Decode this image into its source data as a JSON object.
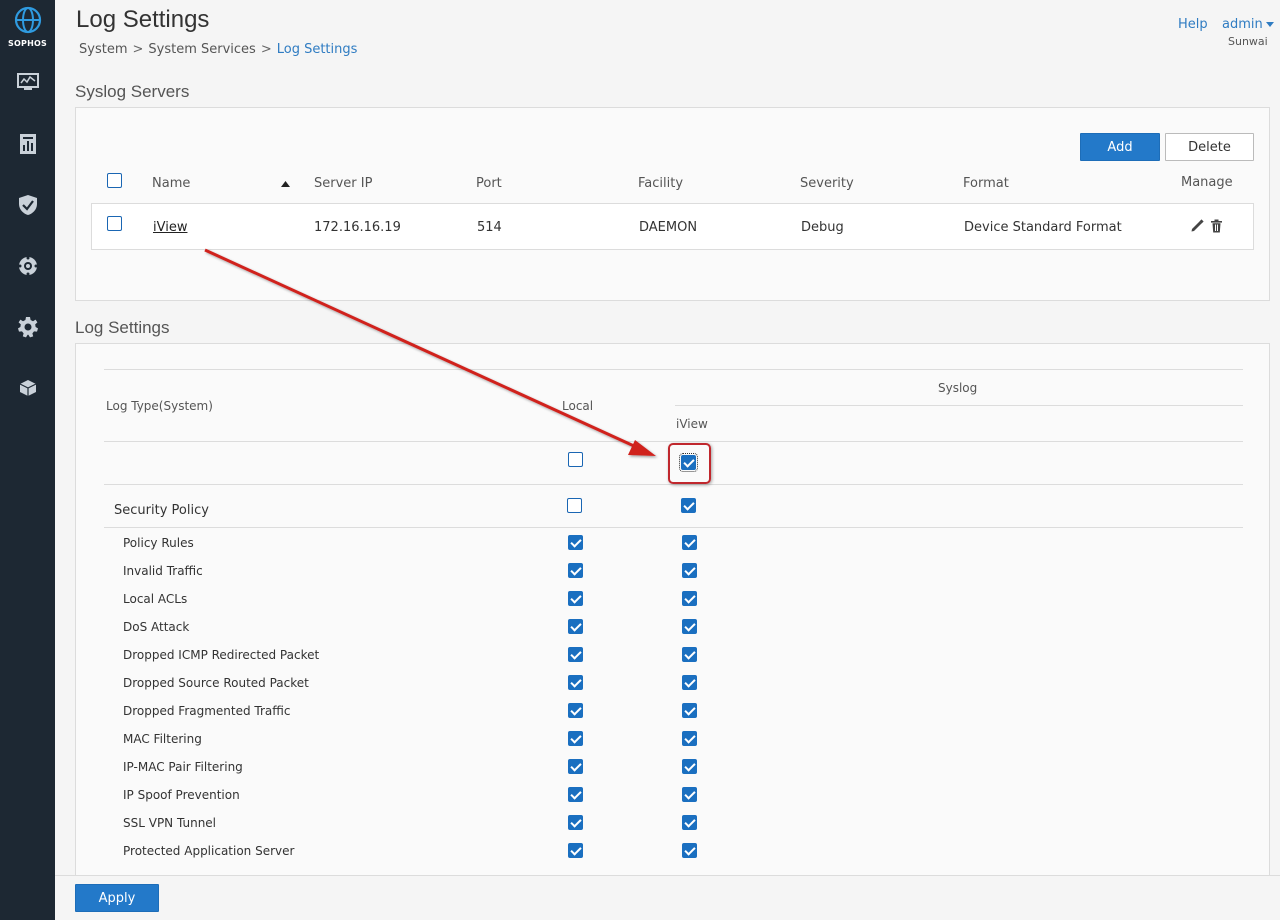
{
  "sidebar": {
    "logo_text": "SOPHOS",
    "items": [
      {
        "name": "monitor-icon"
      },
      {
        "name": "reports-icon"
      },
      {
        "name": "protect-icon"
      },
      {
        "name": "configure-icon"
      },
      {
        "name": "system-settings-icon"
      },
      {
        "name": "package-icon"
      }
    ]
  },
  "header": {
    "title": "Log Settings",
    "breadcrumb": [
      "System",
      "System Services",
      "Log Settings"
    ],
    "help": "Help",
    "user": "admin",
    "org": "Sunwai"
  },
  "syslog": {
    "section_title": "Syslog Servers",
    "add_label": "Add",
    "delete_label": "Delete",
    "columns": {
      "name": "Name",
      "server_ip": "Server IP",
      "port": "Port",
      "facility": "Facility",
      "severity": "Severity",
      "format": "Format",
      "manage": "Manage"
    },
    "rows": [
      {
        "name": "iView",
        "server_ip": "172.16.16.19",
        "port": "514",
        "facility": "DAEMON",
        "severity": "Debug",
        "format": "Device Standard Format"
      }
    ]
  },
  "log_settings": {
    "section_title": "Log Settings",
    "log_type_header": "Log Type(System)",
    "local_header": "Local",
    "syslog_header": "Syslog",
    "server_header": "iView",
    "select_all": {
      "local": false,
      "iview": true
    },
    "group": {
      "label": "Security Policy",
      "local": false,
      "iview": true
    },
    "items": [
      {
        "label": "Policy Rules",
        "local": true,
        "iview": true
      },
      {
        "label": "Invalid Traffic",
        "local": true,
        "iview": true
      },
      {
        "label": "Local ACLs",
        "local": true,
        "iview": true
      },
      {
        "label": "DoS Attack",
        "local": true,
        "iview": true
      },
      {
        "label": "Dropped ICMP Redirected Packet",
        "local": true,
        "iview": true
      },
      {
        "label": "Dropped Source Routed Packet",
        "local": true,
        "iview": true
      },
      {
        "label": "Dropped Fragmented Traffic",
        "local": true,
        "iview": true
      },
      {
        "label": "MAC Filtering",
        "local": true,
        "iview": true
      },
      {
        "label": "IP-MAC Pair Filtering",
        "local": true,
        "iview": true
      },
      {
        "label": "IP Spoof Prevention",
        "local": true,
        "iview": true
      },
      {
        "label": "SSL VPN Tunnel",
        "local": true,
        "iview": true
      },
      {
        "label": "Protected Application Server",
        "local": true,
        "iview": true
      }
    ]
  },
  "footer": {
    "apply_label": "Apply"
  },
  "colors": {
    "accent": "#2379c9",
    "sidebar": "#1d2833",
    "annotation": "#d0201f"
  }
}
